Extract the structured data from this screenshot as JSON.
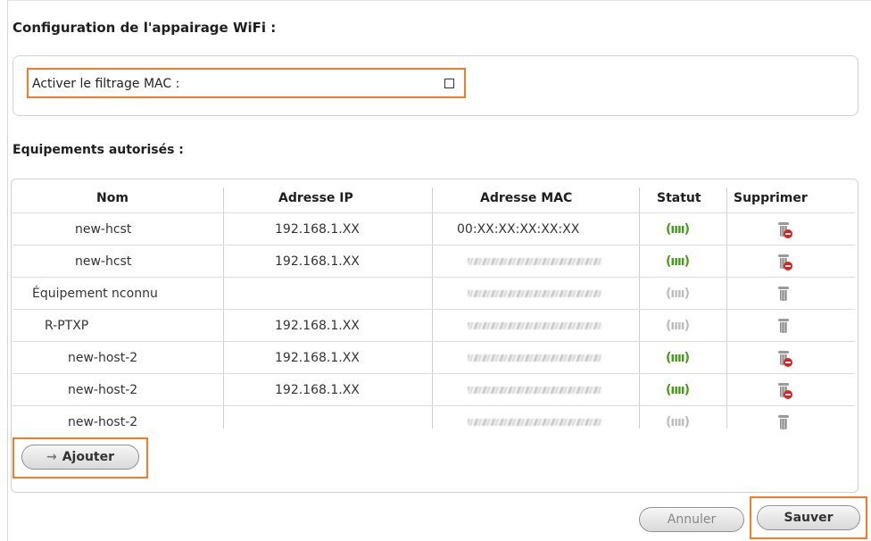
{
  "wifi_pairing": {
    "title": "Configuration de l'appairage WiFi :",
    "mac_filter_label": "Activer le filtrage MAC :",
    "mac_filter_checked": false
  },
  "devices": {
    "title": "Equipements autorisés :",
    "columns": [
      "Nom",
      "Adresse IP",
      "Adresse MAC",
      "Statut",
      "Supprimer"
    ],
    "rows": [
      {
        "name": "new-hcst",
        "ip": "192.168.1.XX",
        "mac": "00:XX:XX:XX:XX:XX",
        "status": "(ıııı)"
      },
      {
        "name": "new-hcst",
        "ip": "192.168.1.XX",
        "mac": "",
        "status": "(ıııı)"
      },
      {
        "name": "Équipement nconnu",
        "ip": "",
        "mac": "",
        "status": "(ıııı)"
      },
      {
        "name": "R-PTXP",
        "ip": "192.168.1.XX",
        "mac": "",
        "status": "(ıııı)"
      },
      {
        "name": "new-host-2",
        "ip": "192.168.1.XX",
        "mac": "",
        "status": "(ıııı)"
      },
      {
        "name": "new-host-2",
        "ip": "192.168.1.XX",
        "mac": "",
        "status": "(ıııı)"
      },
      {
        "name": "new-host-2",
        "ip": "",
        "mac": "",
        "status": "(ıııı)"
      }
    ],
    "status_state": [
      "connected",
      "connected",
      "disconnected",
      "disconnected",
      "connected",
      "connected",
      "disconnected"
    ]
  },
  "actions": {
    "add_label": "Ajouter",
    "cancel_label": "Annuler",
    "save_label": "Sauver"
  },
  "colors": {
    "highlight": "#f07c2a",
    "status_on": "#4a9a1a",
    "status_off": "#bdbdbd",
    "delete_badge": "#e0201c"
  },
  "icons": {
    "status": "wifi-signal-icon",
    "delete": "trash-icon",
    "add": "arrow-right-icon"
  }
}
